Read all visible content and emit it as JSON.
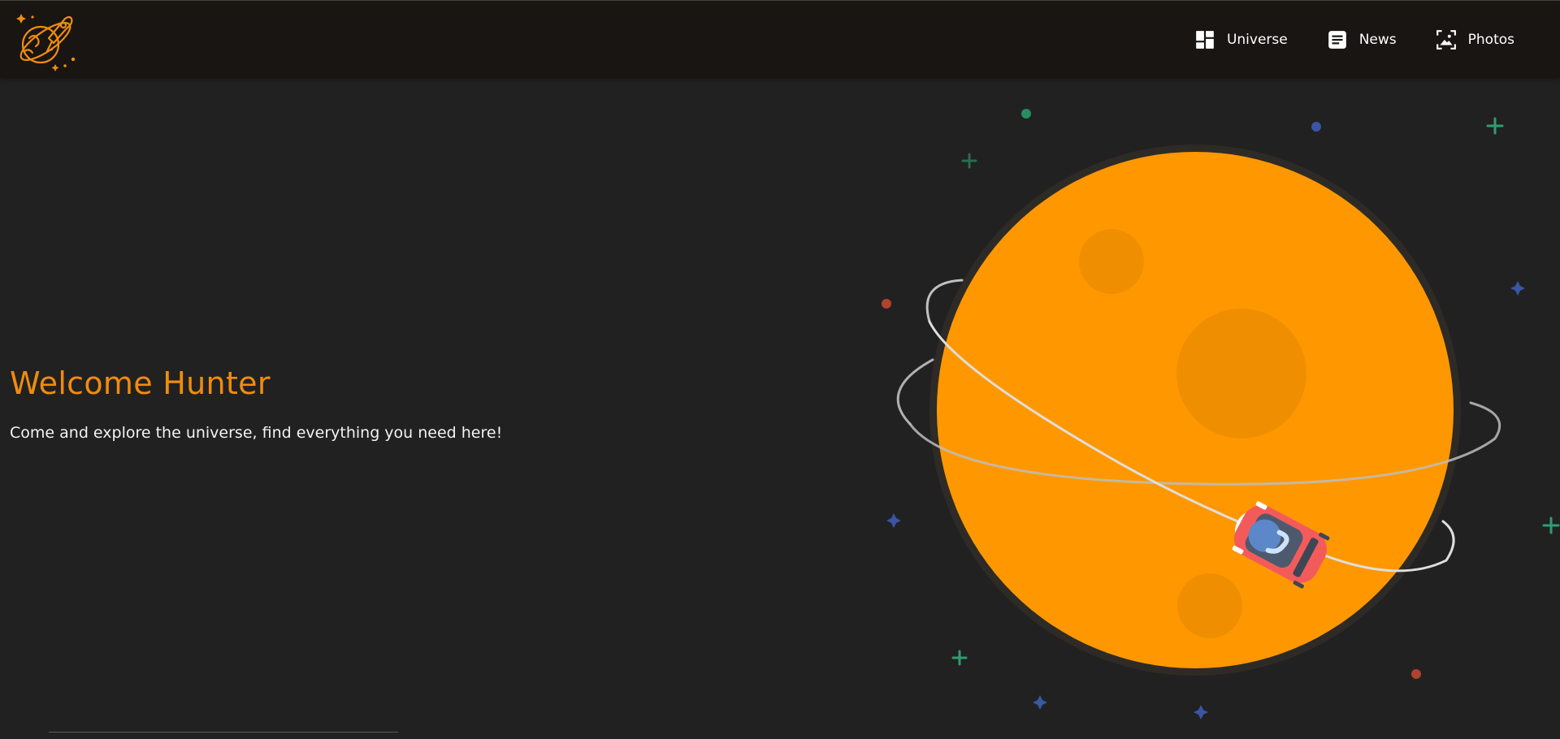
{
  "header": {
    "logo_icon": "rocket-planet-logo-icon",
    "nav": [
      {
        "label": "Universe",
        "icon": "dashboard-icon"
      },
      {
        "label": "News",
        "icon": "article-icon"
      },
      {
        "label": "Photos",
        "icon": "photo-frame-icon"
      }
    ]
  },
  "hero": {
    "title": "Welcome Hunter",
    "subtitle": "Come and explore the universe, find everything you need here!"
  },
  "colors": {
    "accent": "#f08c0c",
    "planet": "#ff9800",
    "background": "#212121",
    "navbar": "#181512"
  }
}
